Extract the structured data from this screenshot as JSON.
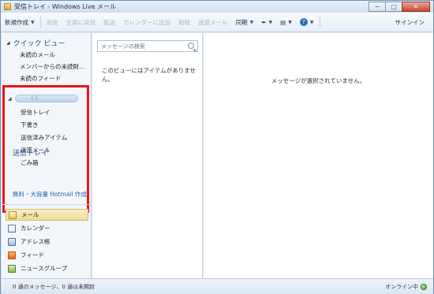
{
  "window": {
    "title": "受信トレイ - Windows Live メール",
    "min_label": "─",
    "max_label": "□",
    "close_label": "✕"
  },
  "toolbar": {
    "new_label": "新規作成",
    "reply_label": "返信",
    "reply_all_label": "全員に返信",
    "forward_label": "転送",
    "add_calendar_label": "カレンダーに追加",
    "delete_label": "削除",
    "junk_label": "迷惑メール",
    "sync_label": "同期",
    "pen_glyph": "✒",
    "view_glyph": "▤",
    "help_glyph": "?",
    "arrow_glyph": "▼",
    "signin_label": "サインイン"
  },
  "quick_views": {
    "header": "クイック ビュー",
    "items": [
      "未読のメール",
      "メンバーからの未読財...",
      "未読のフィード"
    ]
  },
  "account": {
    "name": "(              )",
    "folders": [
      "受信トレイ",
      "下書き",
      "送信済みアイテム",
      "迷惑メール",
      "ごみ箱"
    ]
  },
  "outbox_label": "送信トレイ",
  "hotmail_link": "無料・大容量 Hotmail 作成",
  "modules": [
    "メール",
    "カレンダー",
    "アドレス帳",
    "フィード",
    "ニュースグループ"
  ],
  "list": {
    "search_placeholder": "メッセージの検索",
    "empty_text": "このビューにはアイテムがありません。"
  },
  "reading": {
    "no_selection": "メッセージが選択されていません。"
  },
  "status": {
    "left": "0 通のメッセージ、0 通は未開封",
    "right": "オンライン中"
  },
  "colors": {
    "highlight_border": "#e8141c",
    "accent_text": "#1e4f8a"
  }
}
